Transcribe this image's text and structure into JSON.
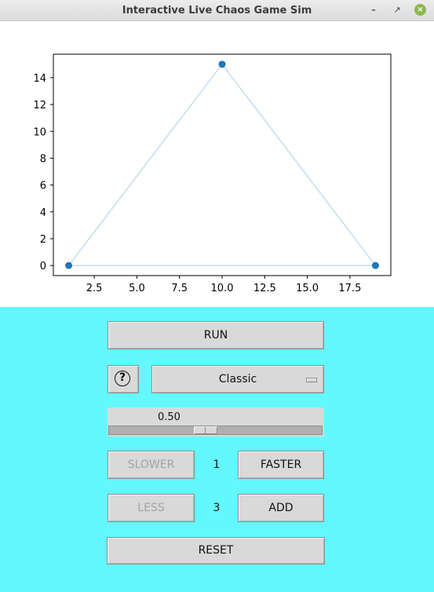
{
  "window": {
    "title": "Interactive Live Chaos Game Sim"
  },
  "buttons": {
    "run": "RUN",
    "help": "?",
    "slower": "SLOWER",
    "faster": "FASTER",
    "less": "LESS",
    "add": "ADD",
    "reset": "RESET"
  },
  "mode_select": {
    "selected": "Classic"
  },
  "ratio_scale": {
    "value": "0.50",
    "fraction": 0.5
  },
  "speed": {
    "value": "1"
  },
  "vertex_count": {
    "value": "3"
  },
  "colors": {
    "control_bg": "#62f8fd",
    "point": "#1f77b4",
    "edge": "#c6dff0",
    "button_bg": "#d9d9d9"
  },
  "chart_data": {
    "type": "scatter",
    "title": "",
    "xlabel": "",
    "ylabel": "",
    "xlim": [
      0.1,
      19.9
    ],
    "ylim": [
      -0.75,
      15.75
    ],
    "xticks": [
      2.5,
      5.0,
      7.5,
      10.0,
      12.5,
      15.0,
      17.5
    ],
    "xtick_labels": [
      "2.5",
      "5.0",
      "7.5",
      "10.0",
      "12.5",
      "15.0",
      "17.5"
    ],
    "yticks": [
      0,
      2,
      4,
      6,
      8,
      10,
      12,
      14
    ],
    "ytick_labels": [
      "0",
      "2",
      "4",
      "6",
      "8",
      "10",
      "12",
      "14"
    ],
    "series": [
      {
        "points": [
          {
            "x": 1,
            "y": 0
          },
          {
            "x": 10,
            "y": 15
          },
          {
            "x": 19,
            "y": 0
          }
        ]
      }
    ],
    "outline_closed": true,
    "grid": false
  }
}
